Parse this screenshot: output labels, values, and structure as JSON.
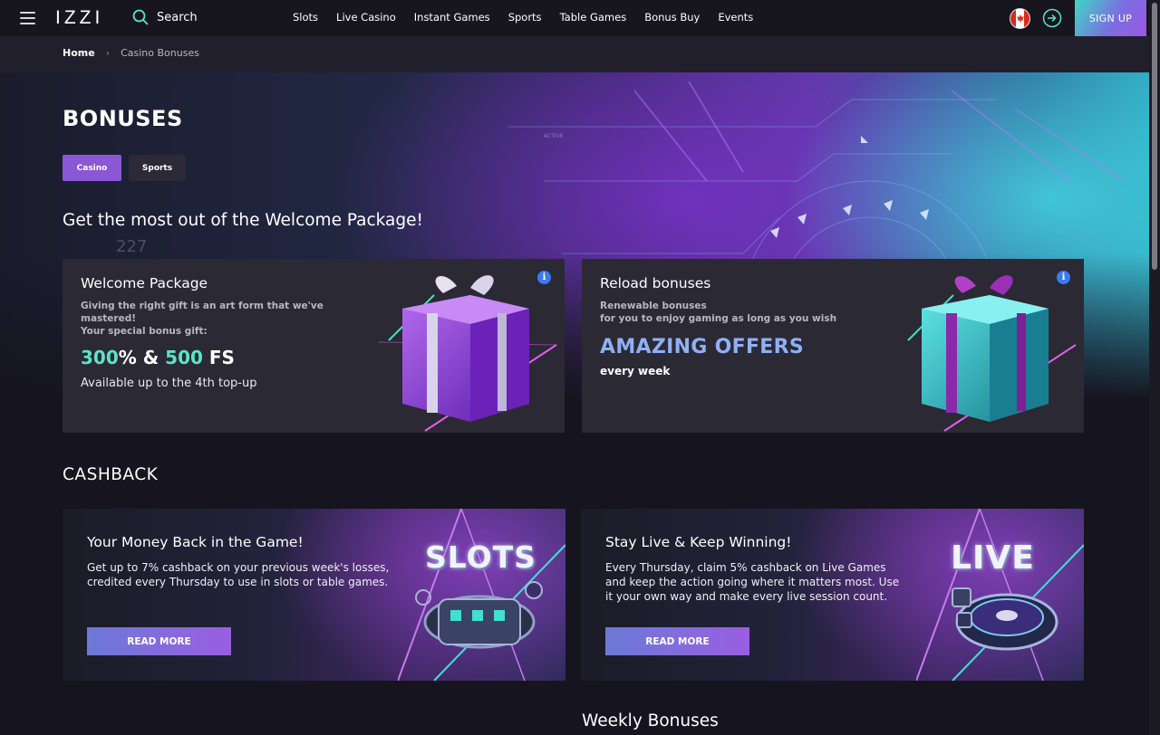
{
  "header": {
    "logo": "IZZI",
    "search_label": "Search",
    "nav": [
      "Slots",
      "Live Casino",
      "Instant Games",
      "Sports",
      "Table Games",
      "Bonus Buy",
      "Events"
    ],
    "signup_label": "SIGN UP"
  },
  "breadcrumb": {
    "home": "Home",
    "current": "Casino Bonuses"
  },
  "page": {
    "title": "BONUSES",
    "tabs": [
      {
        "label": "Casino",
        "active": true
      },
      {
        "label": "Sports",
        "active": false
      }
    ],
    "welcome_heading": "Get the most out of the Welcome Package!"
  },
  "cards": {
    "welcome": {
      "title": "Welcome Package",
      "desc_lines": [
        "Giving the right gift is an art form that we've",
        "mastered!",
        "Your special bonus gift:"
      ],
      "offer_num1": "300",
      "offer_mid": "% & ",
      "offer_num2": "500",
      "offer_suffix": " FS",
      "available": "Available up to the 4th top-up",
      "info_icon": "i"
    },
    "reload": {
      "title": "Reload bonuses",
      "desc_lines": [
        "Renewable bonuses",
        "for you to enjoy gaming as long as you wish"
      ],
      "highlight": "AMAZING OFFERS",
      "sub": "every week",
      "info_icon": "i"
    }
  },
  "cashback": {
    "heading": "CASHBACK",
    "items": [
      {
        "title": "Your Money Back in the Game!",
        "text": "Get up to 7% cashback on your previous week's losses, credited every Thursday to use in slots or table games.",
        "button": "READ MORE",
        "art_word": "SLOTS"
      },
      {
        "title": "Stay Live & Keep Winning!",
        "text": "Every Thursday, claim 5% cashback on Live Games and keep the action going where it matters most. Use it your own way and make every live session count.",
        "button": "READ MORE",
        "art_word": "LIVE"
      }
    ]
  },
  "weekly_heading": "Weekly Bonuses",
  "colors": {
    "accent": "#8a58d4",
    "teal": "#5de3c8",
    "info_blue": "#3b7bf0",
    "highlight_blue": "#8fb0f4"
  },
  "icons": [
    "menu-icon",
    "search-icon",
    "canada-flag-icon",
    "login-icon",
    "info-icon",
    "gift-box-icon",
    "slot-reel-icon",
    "roulette-wheel-icon",
    "chevron-right-icon"
  ]
}
